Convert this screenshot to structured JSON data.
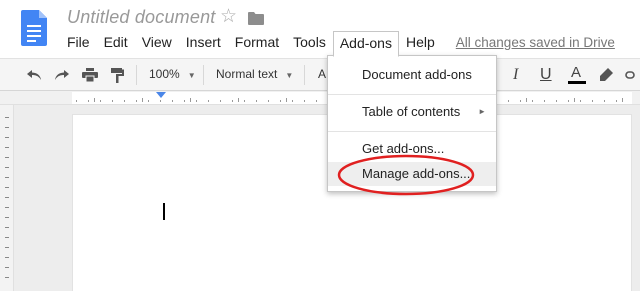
{
  "header": {
    "title": "Untitled document",
    "star_icon": "star-icon",
    "folder_icon": "folder-icon",
    "logo_icon": "docs-logo-icon",
    "logo_color": "#4285f4"
  },
  "menubar": {
    "items": [
      "File",
      "Edit",
      "View",
      "Insert",
      "Format",
      "Tools",
      "Add-ons",
      "Help"
    ],
    "active": "Add-ons",
    "saved_status": "All changes saved in Drive"
  },
  "toolbar": {
    "icons": [
      "undo-icon",
      "redo-icon",
      "print-icon",
      "paint-format-icon",
      "italic-icon",
      "underline-icon",
      "text-color-icon",
      "highlight-icon",
      "link-icon"
    ],
    "zoom": "100%",
    "style": "Normal text",
    "font_partial": "A",
    "italic_label": "I",
    "underline_label": "U",
    "text_color_label": "A"
  },
  "addons_menu": {
    "items": [
      {
        "label": "Document add-ons",
        "submenu": false
      },
      {
        "label": "Table of contents",
        "submenu": true
      },
      {
        "label": "Get add-ons...",
        "submenu": false
      },
      {
        "label": "Manage add-ons...",
        "submenu": false,
        "highlighted": true
      }
    ],
    "highlight_color": "#e02020"
  }
}
